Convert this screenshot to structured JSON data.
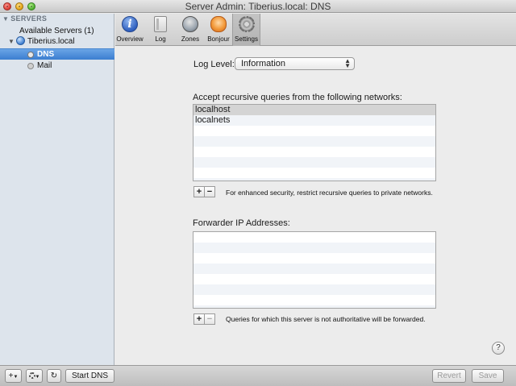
{
  "window": {
    "title": "Server Admin: Tiberius.local: DNS"
  },
  "sidebar": {
    "header": "SERVERS",
    "available_servers": "Available Servers (1)",
    "server": "Tiberius.local",
    "services": [
      {
        "label": "DNS",
        "selected": true
      },
      {
        "label": "Mail",
        "selected": false
      }
    ]
  },
  "toolbar": {
    "tabs": [
      {
        "label": "Overview",
        "icon": "info-icon"
      },
      {
        "label": "Log",
        "icon": "log-icon"
      },
      {
        "label": "Zones",
        "icon": "zones-icon"
      },
      {
        "label": "Bonjour",
        "icon": "bonjour-icon"
      },
      {
        "label": "Settings",
        "icon": "gear-icon",
        "selected": true
      }
    ]
  },
  "settings": {
    "log_level_label": "Log Level:",
    "log_level_value": "Information",
    "recursive_label": "Accept recursive queries from the following networks:",
    "networks": [
      "localhost",
      "localnets"
    ],
    "recursive_note": "For enhanced security, restrict recursive queries to private networks.",
    "forwarder_label": "Forwarder IP Addresses:",
    "forwarders": [],
    "forwarder_note": "Queries for which this server is not authoritative will be forwarded.",
    "add_symbol": "+",
    "remove_symbol": "−",
    "help_symbol": "?"
  },
  "bottom_bar": {
    "add_symbol": "+",
    "refresh_symbol": "↻",
    "start_label": "Start DNS",
    "revert_label": "Revert",
    "save_label": "Save"
  },
  "colors": {
    "selection": "#3b7ed0",
    "sidebar_bg": "#dde4ec"
  }
}
